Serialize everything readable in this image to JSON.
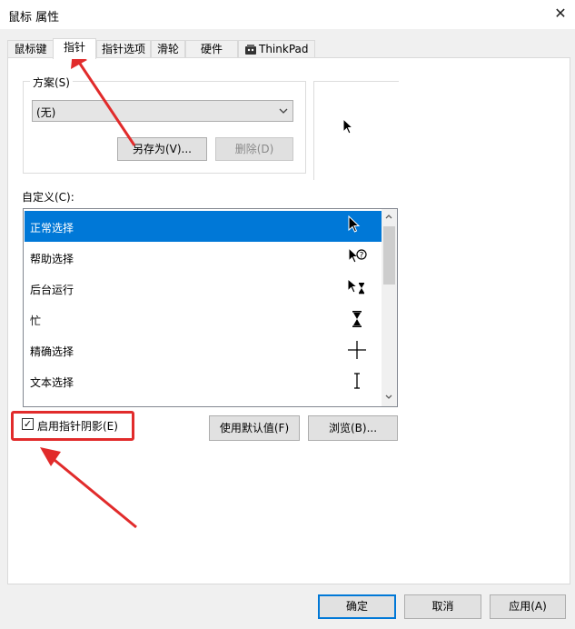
{
  "window": {
    "title": "鼠标 属性",
    "close_glyph": "✕"
  },
  "tabs": [
    {
      "label": "鼠标键"
    },
    {
      "label": "指针"
    },
    {
      "label": "指针选项"
    },
    {
      "label": "滑轮"
    },
    {
      "label": "硬件"
    },
    {
      "label": "ThinkPad"
    }
  ],
  "scheme": {
    "label": "方案(S)",
    "selected": "(无)",
    "save_as_label": "另存为(V)...",
    "delete_label": "删除(D)"
  },
  "customize": {
    "label": "自定义(C):",
    "items": [
      {
        "label": "正常选择",
        "icon": "arrow-cursor-icon",
        "selected": true
      },
      {
        "label": "帮助选择",
        "icon": "help-cursor-icon",
        "selected": false
      },
      {
        "label": "后台运行",
        "icon": "working-in-background-cursor-icon",
        "selected": false
      },
      {
        "label": "忙",
        "icon": "hourglass-cursor-icon",
        "selected": false
      },
      {
        "label": "精确选择",
        "icon": "crosshair-cursor-icon",
        "selected": false
      },
      {
        "label": "文本选择",
        "icon": "text-beam-cursor-icon",
        "selected": false
      }
    ]
  },
  "shadow": {
    "label": "启用指针阴影(E)",
    "checked": true,
    "check_glyph": "✓"
  },
  "buttons": {
    "use_default": "使用默认值(F)",
    "browse": "浏览(B)...",
    "ok": "确定",
    "cancel": "取消",
    "apply": "应用(A)"
  },
  "colors": {
    "selection": "#0078d7",
    "annotation_red": "#e12b2b",
    "panel": "#ffffff",
    "background": "#f0f0f0"
  }
}
